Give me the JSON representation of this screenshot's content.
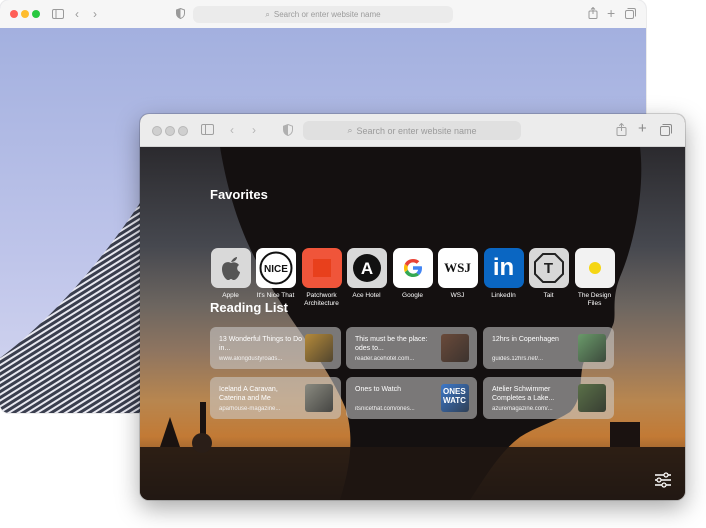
{
  "back_window": {
    "address_placeholder": "Search or enter website name"
  },
  "front_window": {
    "address_placeholder": "Search or enter website name",
    "favorites_title": "Favorites",
    "favorites": [
      {
        "label": "Apple",
        "icon": "apple-logo-icon",
        "color": "#d9d9d9"
      },
      {
        "label": "It's Nice That",
        "icon": "its-nice-that-logo-icon",
        "color": "#ffffff"
      },
      {
        "label": "Patchwork Architecture",
        "icon": "patchwork-logo-icon",
        "color": "#f0553a"
      },
      {
        "label": "Ace Hotel",
        "icon": "ace-hotel-logo-icon",
        "color": "#d8d8d8"
      },
      {
        "label": "Google",
        "icon": "google-logo-icon",
        "color": "#ffffff"
      },
      {
        "label": "WSJ",
        "icon": "wsj-logo-icon",
        "color": "#ffffff",
        "text": "WSJ"
      },
      {
        "label": "LinkedIn",
        "icon": "linkedin-logo-icon",
        "color": "#0a66c2",
        "text": "in"
      },
      {
        "label": "Tait",
        "icon": "tait-logo-icon",
        "color": "#d8d8d8",
        "text": "T"
      },
      {
        "label": "The Design Files",
        "icon": "design-files-logo-icon",
        "color": "#f2f2f2"
      }
    ],
    "reading_list_title": "Reading List",
    "reading_list": [
      {
        "title": "13 Wonderful Things to Do in...",
        "url": "www.alongdustyroads...",
        "thumb": "#b58a3a"
      },
      {
        "title": "This must be the place: odes to...",
        "url": "reader.acehotel.com...",
        "thumb": "#6a4a3a"
      },
      {
        "title": "12hrs in Copenhagen",
        "url": "guides.12hrs.net/...",
        "thumb": "#6a9a6a"
      },
      {
        "title": "Iceland A Caravan, Caterina and Me",
        "url": "aparhouse-magazine...",
        "thumb": "#8a8a80"
      },
      {
        "title": "Ones to Watch",
        "url": "itsnicethat.com/ones...",
        "thumb": "#3d78c8",
        "thumb_text": "ONES WATC"
      },
      {
        "title": "Atelier Schwimmer Completes a Lake...",
        "url": "azuremagazine.com/...",
        "thumb": "#5a7048"
      }
    ]
  }
}
